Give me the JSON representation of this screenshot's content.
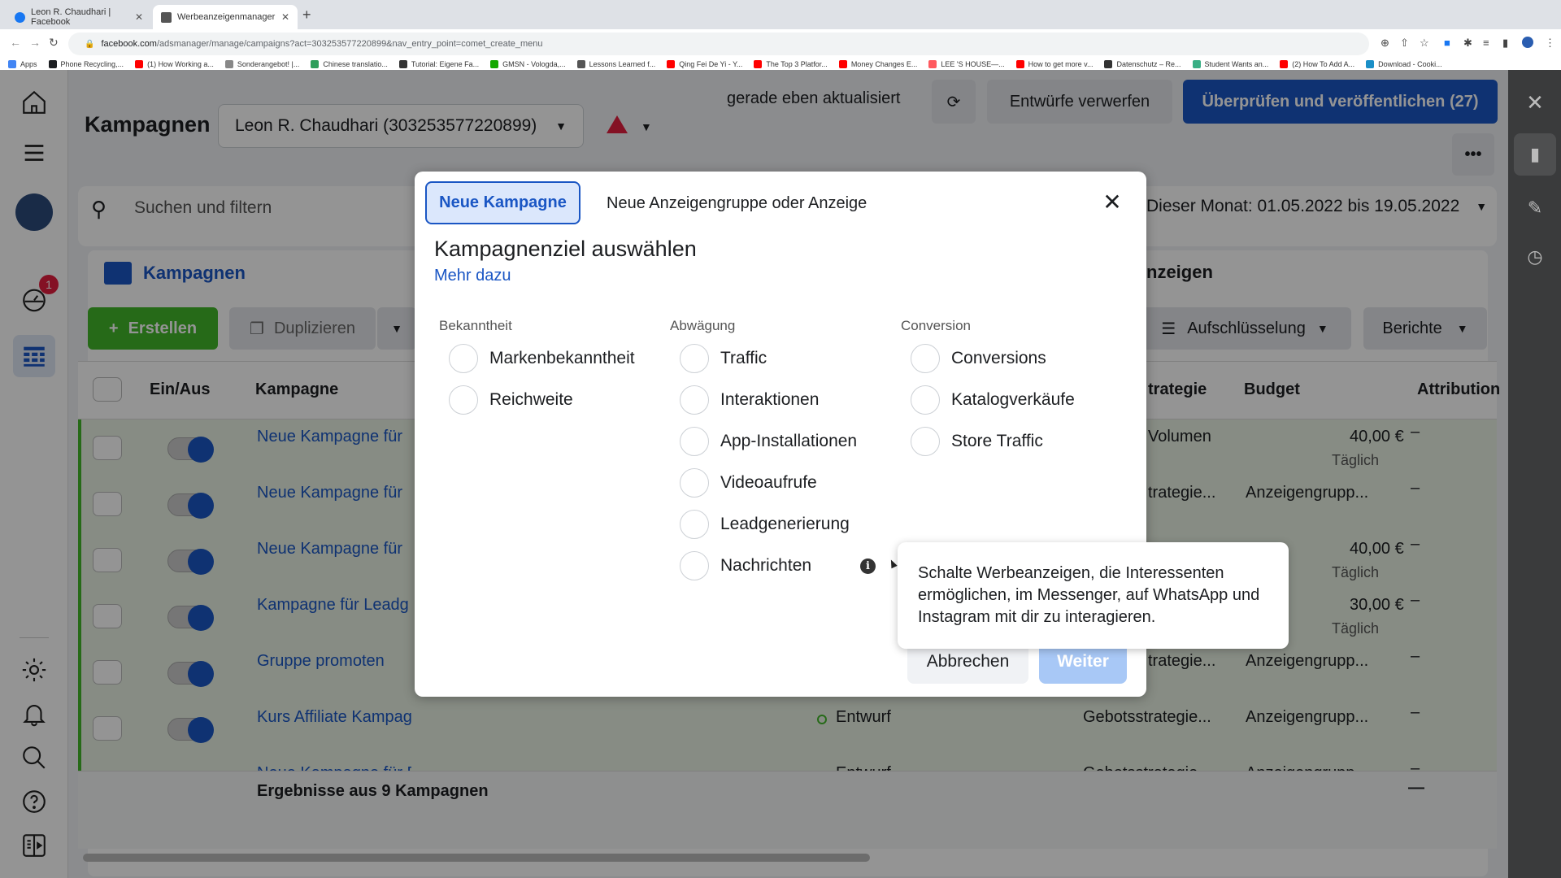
{
  "browser": {
    "tabs": [
      {
        "title": "Leon R. Chaudhari | Facebook",
        "favicon": "facebook-icon",
        "active": false
      },
      {
        "title": "Werbeanzeigenmanager - Wer",
        "favicon": "ads-manager-icon",
        "active": true
      }
    ],
    "url_host": "facebook.com",
    "url_path": "/adsmanager/manage/campaigns?act=303253577220899&nav_entry_point=comet_create_menu",
    "bookmarks": [
      {
        "label": "Apps",
        "icon": "apps-grid-icon",
        "color": "#4285f4"
      },
      {
        "label": "Phone Recycling,...",
        "icon": "o2-icon",
        "color": "#1c1e21"
      },
      {
        "label": "(1) How Working a...",
        "icon": "youtube-icon",
        "color": "#ff0000"
      },
      {
        "label": "Sonderangebot! |...",
        "icon": "checkmark-icon",
        "color": "#888888"
      },
      {
        "label": "Chinese translatio...",
        "icon": "translate-icon",
        "color": "#2e9e5b"
      },
      {
        "label": "Tutorial: Eigene Fa...",
        "icon": "hash-icon",
        "color": "#333333"
      },
      {
        "label": "GMSN - Vologda,...",
        "icon": "upwork-icon",
        "color": "#14a800"
      },
      {
        "label": "Lessons Learned f...",
        "icon": "er-icon",
        "color": "#555555"
      },
      {
        "label": "Qing Fei De Yi - Y...",
        "icon": "youtube-icon",
        "color": "#ff0000"
      },
      {
        "label": "The Top 3 Platfor...",
        "icon": "youtube-icon",
        "color": "#ff0000"
      },
      {
        "label": "Money Changes E...",
        "icon": "youtube-icon",
        "color": "#ff0000"
      },
      {
        "label": "LEE 'S HOUSE—...",
        "icon": "airbnb-icon",
        "color": "#ff5a5f"
      },
      {
        "label": "How to get more v...",
        "icon": "youtube-icon",
        "color": "#ff0000"
      },
      {
        "label": "Datenschutz – Re...",
        "icon": "datenschutz-icon",
        "color": "#333333"
      },
      {
        "label": "Student Wants an...",
        "icon": "t-icon",
        "color": "#3aaf85"
      },
      {
        "label": "(2) How To Add A...",
        "icon": "youtube-icon",
        "color": "#ff0000"
      },
      {
        "label": "Download - Cooki...",
        "icon": "cookie-icon",
        "color": "#1a8fc7"
      }
    ]
  },
  "page": {
    "title": "Kampagnen",
    "account_selector": "Leon R. Chaudhari (303253577220899)",
    "status_text": "gerade eben aktualisiert",
    "discard_label": "Entwürfe verwerfen",
    "publish_label": "Überprüfen und veröffentlichen (27)",
    "search_placeholder": "Suchen und filtern",
    "date_range": "Dieser Monat: 01.05.2022 bis 19.05.2022",
    "campaigns_tab": "Kampagnen",
    "ads_tab_partial": "nzeigen",
    "notification_count": "1",
    "toolbar": {
      "create": "Erstellen",
      "duplicate": "Duplizieren",
      "breakdown": "Aufschlüsselung",
      "reports": "Berichte"
    },
    "table": {
      "headers": {
        "toggle": "Ein/Aus",
        "campaign": "Kampagne",
        "bid_strategy": "trategie",
        "budget": "Budget",
        "attribution": "Attribution"
      },
      "rows": [
        {
          "name": "Neue Kampagne für",
          "on": true,
          "bid": "Volumen",
          "budget": "40,00 €",
          "budget_sub": "Täglich",
          "attr": "–"
        },
        {
          "name": "Neue Kampagne für",
          "on": true,
          "bid": "trategie...",
          "budget": "Anzeigengrupp...",
          "budget_sub": "",
          "attr": "–"
        },
        {
          "name": "Neue Kampagne für",
          "on": true,
          "bid": "",
          "budget": "40,00 €",
          "budget_sub": "Täglich",
          "attr": "–"
        },
        {
          "name": "Kampagne für Leadg",
          "on": true,
          "bid": "",
          "budget": "30,00 €",
          "budget_sub": "Täglich",
          "attr": "–"
        },
        {
          "name": "Gruppe promoten",
          "on": true,
          "bid": "trategie...",
          "budget": "Anzeigengrupp...",
          "budget_sub": "",
          "attr": "–"
        },
        {
          "name": "Kurs Affiliate Kampagne",
          "on": true,
          "status": "Entwurf",
          "bid": "Gebotsstrategie...",
          "budget": "Anzeigengrupp...",
          "budget_sub": "",
          "attr": "–"
        },
        {
          "name": "Neue Kampagne für Beitragsinteraktion",
          "on": true,
          "status": "Entwurf",
          "bid": "Gebotsstrategie...",
          "budget": "Anzeigengrupp...",
          "budget_sub": "",
          "attr": "–"
        }
      ],
      "footer": "Ergebnisse aus 9 Kampagnen",
      "footer_attr": "—"
    }
  },
  "modal": {
    "tabs": [
      {
        "label": "Neue Kampagne",
        "active": true
      },
      {
        "label": "Neue Anzeigengruppe oder Anzeige",
        "active": false
      }
    ],
    "title": "Kampagnenziel auswählen",
    "learn_more": "Mehr dazu",
    "columns": [
      {
        "heading": "Bekanntheit",
        "options": [
          "Markenbekanntheit",
          "Reichweite"
        ]
      },
      {
        "heading": "Abwägung",
        "options": [
          "Traffic",
          "Interaktionen",
          "App-Installationen",
          "Videoaufrufe",
          "Leadgenerierung",
          "Nachrichten"
        ]
      },
      {
        "heading": "Conversion",
        "options": [
          "Conversions",
          "Katalogverkäufe",
          "Store Traffic"
        ]
      }
    ],
    "cancel_label": "Abbrechen",
    "next_label": "Weiter",
    "tooltip": "Schalte Werbeanzeigen, die Interessenten ermöglichen, im Messenger, auf WhatsApp und Instagram mit dir zu interagieren."
  },
  "colors": {
    "primary": "#1a56c4",
    "create_green": "#42b72a",
    "alert_red": "#e41e3f"
  }
}
